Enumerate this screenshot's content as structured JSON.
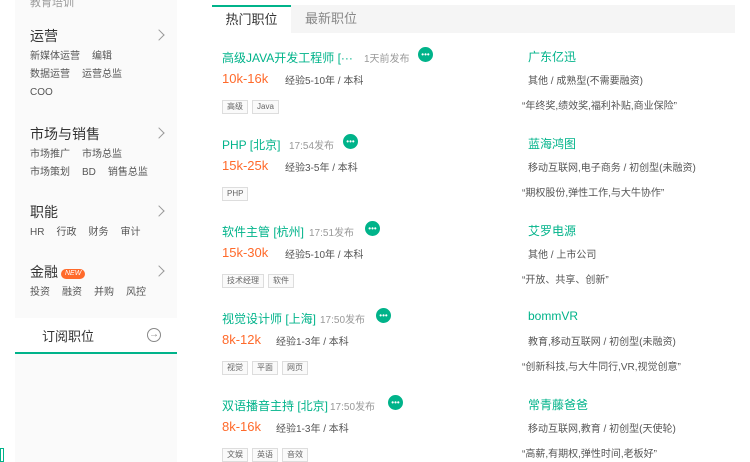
{
  "sidebar": {
    "cut_text": "教育培训",
    "categories": [
      {
        "title": "运营",
        "links": [
          "新媒体运营",
          "编辑",
          "数据运营",
          "运营总监",
          "COO"
        ]
      },
      {
        "title": "市场与销售",
        "links": [
          "市场推广",
          "市场总监",
          "市场策划",
          "BD",
          "销售总监"
        ]
      },
      {
        "title": "职能",
        "links": [
          "HR",
          "行政",
          "财务",
          "审计"
        ]
      },
      {
        "title": "金融",
        "badge": "NEW",
        "links": [
          "投资",
          "融资",
          "并购",
          "风控"
        ]
      }
    ],
    "subscribe_label": "订阅职位",
    "subscribe_icon": "→"
  },
  "tabs": {
    "hot": "热门职位",
    "latest": "最新职位"
  },
  "jobs": [
    {
      "title": "高级JAVA开发工程师 [···",
      "time": "1天前发布",
      "salary": "10k-16k",
      "requirements": "经验5-10年 / 本科",
      "tags": [
        "高级",
        "Java"
      ],
      "company": "广东亿迅",
      "industry": "其他 / 成熟型(不需要融资)",
      "perk": "“年终奖,绩效奖,福利补贴,商业保险”"
    },
    {
      "title": "PHP [北京]",
      "time": "17:54发布",
      "salary": "15k-25k",
      "requirements": "经验3-5年 / 本科",
      "tags": [
        "PHP"
      ],
      "company": "蓝海鸿图",
      "industry": "移动互联网,电子商务 / 初创型(未融资)",
      "perk": "“期权股份,弹性工作,与大牛协作”"
    },
    {
      "title": "软件主管 [杭州]",
      "time": "17:51发布",
      "salary": "15k-30k",
      "requirements": "经验5-10年 / 本科",
      "tags": [
        "技术经理",
        "软件"
      ],
      "company": "艾罗电源",
      "industry": "其他 / 上市公司",
      "perk": "“开放、共享、创新”"
    },
    {
      "title": "视觉设计师 [上海]",
      "time": "17:50发布",
      "salary": "8k-12k",
      "requirements": "经验1-3年 / 本科",
      "tags": [
        "视觉",
        "平面",
        "网页"
      ],
      "company": "bommVR",
      "industry": "教育,移动互联网 / 初创型(未融资)",
      "perk": "“创新科技,与大牛同行,VR,视觉创意”"
    },
    {
      "title": "双语播音主持 [北京]",
      "time": "17:50发布",
      "salary": "8k-16k",
      "requirements": "经验1-3年 / 本科",
      "tags": [
        "文娱",
        "英语",
        "音效"
      ],
      "company": "常青藤爸爸",
      "industry": "移动互联网,教育 / 初创型(天使轮)",
      "perk": "“高薪,有期权,弹性时间,老板好”"
    }
  ],
  "colors": {
    "accent": "#00b38a",
    "salary": "#ff6a2b",
    "badge": "#ff6a2b"
  },
  "icons": {
    "chat": "chat-bubble-icon",
    "arrow": "chevron-right-icon"
  }
}
